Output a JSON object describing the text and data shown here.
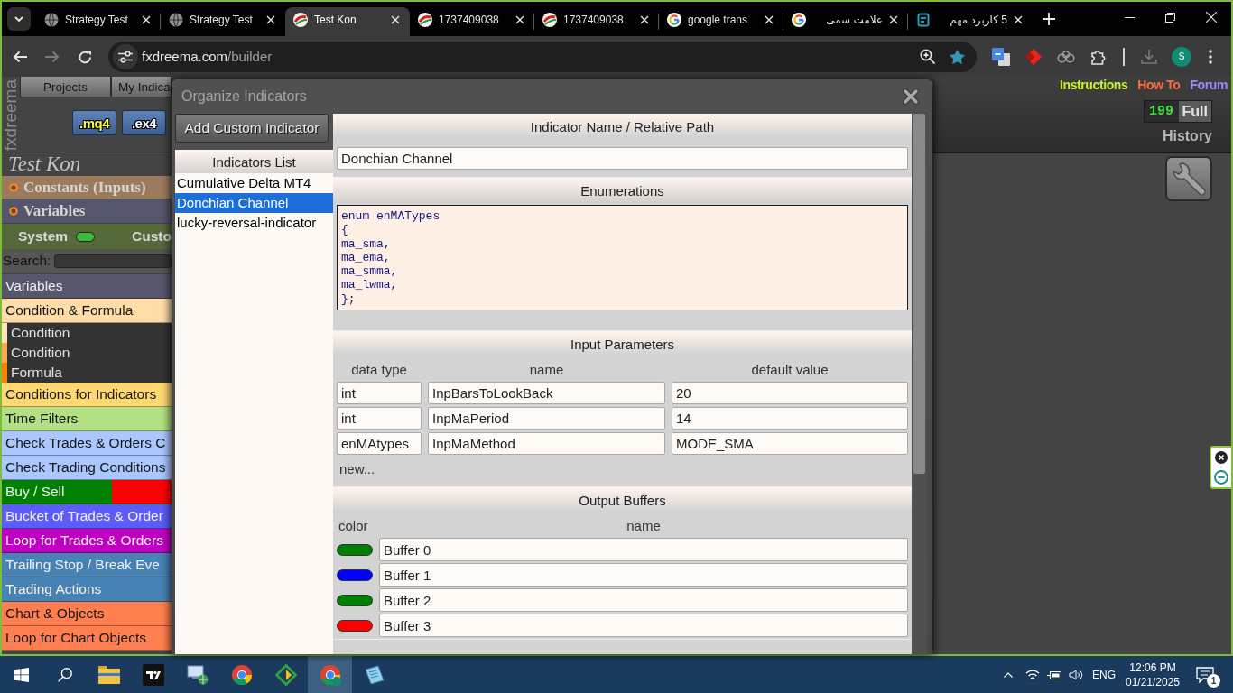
{
  "browser": {
    "tabs": [
      {
        "title": "Strategy Test",
        "selected": false
      },
      {
        "title": "Strategy Test",
        "selected": false
      },
      {
        "title": "Test Kon",
        "selected": true
      },
      {
        "title": "1737409038",
        "selected": false
      },
      {
        "title": "1737409038",
        "selected": false
      },
      {
        "title": "google trans",
        "selected": false
      },
      {
        "title": "علامت سمی",
        "selected": false
      },
      {
        "title": "5 کاربرد مهم",
        "selected": false
      }
    ],
    "forward_disabled": true,
    "address": {
      "host": "fxdreema.com",
      "path": "/builder"
    },
    "bookmarked": true,
    "profile_initial": "S"
  },
  "builder": {
    "logo": "fxdreema",
    "nav_tabs": [
      "Projects",
      "My Indica"
    ],
    "file_buttons": [
      {
        "label": ".mq4",
        "selected": true
      },
      {
        "label": ".ex4",
        "selected": false
      }
    ],
    "project_title": "Test Kon",
    "sections": [
      {
        "label": "Constants (Inputs)",
        "color": "#9c7b5d"
      },
      {
        "label": "Variables",
        "color": "#55566b"
      }
    ],
    "switches": [
      {
        "label": "System",
        "on": true
      },
      {
        "label": "Custo"
      }
    ],
    "search": {
      "label": "Search:"
    },
    "categories": [
      {
        "label": "Variables",
        "color": "#56566c"
      },
      {
        "label": "Condition & Formula",
        "color": "#ffdca8",
        "children": [
          {
            "label": "Condition",
            "color": "#ffe3bd"
          },
          {
            "label": "Condition",
            "color": "#ffa852"
          },
          {
            "label": "Formula",
            "color": "#ff7f00"
          }
        ]
      },
      {
        "label": "Conditions for Indicators",
        "color": "#ffd872"
      },
      {
        "label": "Time Filters",
        "color": "#b3e084"
      },
      {
        "label": "Check Trades & Orders C",
        "color": "#aac8fe"
      },
      {
        "label": "Check Trading Conditions",
        "color": "#aac8fe"
      },
      {
        "label": "Buy / Sell",
        "color": "#008000",
        "second_part": {
          "color": "#ff0000"
        }
      },
      {
        "label": "Bucket of Trades & Order",
        "color": "#5c5cf8"
      },
      {
        "label": "Loop for Trades & Orders",
        "color": "#c000c0"
      },
      {
        "label": "Trailing Stop / Break Eve",
        "color": "#4682b4"
      },
      {
        "label": "Trading Actions",
        "color": "#4682b4"
      },
      {
        "label": "Chart & Objects",
        "color": "#ff7f50"
      },
      {
        "label": "Loop for Chart Objects",
        "color": "#ff7f50"
      }
    ],
    "links": [
      {
        "label": "Instructions",
        "color": "#c6f22b"
      },
      {
        "label": "How To",
        "color": "#ff6a3d"
      },
      {
        "label": "Forum",
        "color": "#9a8cff"
      }
    ],
    "counter": {
      "value": "199",
      "label": "Full"
    },
    "history": "History"
  },
  "dialog": {
    "title": "Organize Indicators",
    "add_button": "Add Custom Indicator",
    "list": {
      "title": "Indicators List",
      "items": [
        {
          "label": "Cumulative Delta MT4",
          "selected": false
        },
        {
          "label": "Donchian Channel",
          "selected": true
        },
        {
          "label": "lucky-reversal-indicator",
          "selected": false
        }
      ]
    },
    "name_section": {
      "title": "Indicator Name / Relative Path",
      "value": "Donchian Channel"
    },
    "enumerations": {
      "title": "Enumerations",
      "code": "enum enMATypes\n{\nma_sma,\nma_ema,\nma_smma,\nma_lwma,\n};"
    },
    "inputs": {
      "title": "Input Parameters",
      "columns": [
        "data type",
        "name",
        "default value"
      ],
      "rows": [
        {
          "data_type": "int",
          "name": "InpBarsToLookBack",
          "default_value": "20"
        },
        {
          "data_type": "int",
          "name": "InpMaPeriod",
          "default_value": "14"
        },
        {
          "data_type": "enMAtypes",
          "name": "InpMaMethod",
          "default_value": "MODE_SMA"
        }
      ],
      "new_link": "new..."
    },
    "outputs": {
      "title": "Output Buffers",
      "columns": [
        "color",
        "name"
      ],
      "buffers": [
        {
          "color": "#008000",
          "name": "Buffer 0"
        },
        {
          "color": "#0000ff",
          "name": "Buffer 1"
        },
        {
          "color": "#008000",
          "name": "Buffer 2"
        },
        {
          "color": "#ff0000",
          "name": "Buffer 3"
        }
      ]
    }
  },
  "taskbar": {
    "apps": [
      {
        "selected": false
      },
      {
        "selected": false
      },
      {
        "selected": false
      },
      {
        "selected": false
      },
      {
        "selected": false
      },
      {
        "selected": true
      },
      {
        "selected": false
      }
    ],
    "language": "ENG",
    "time": "12:06 PM",
    "date": "01/21/2025",
    "notifications": "1"
  }
}
